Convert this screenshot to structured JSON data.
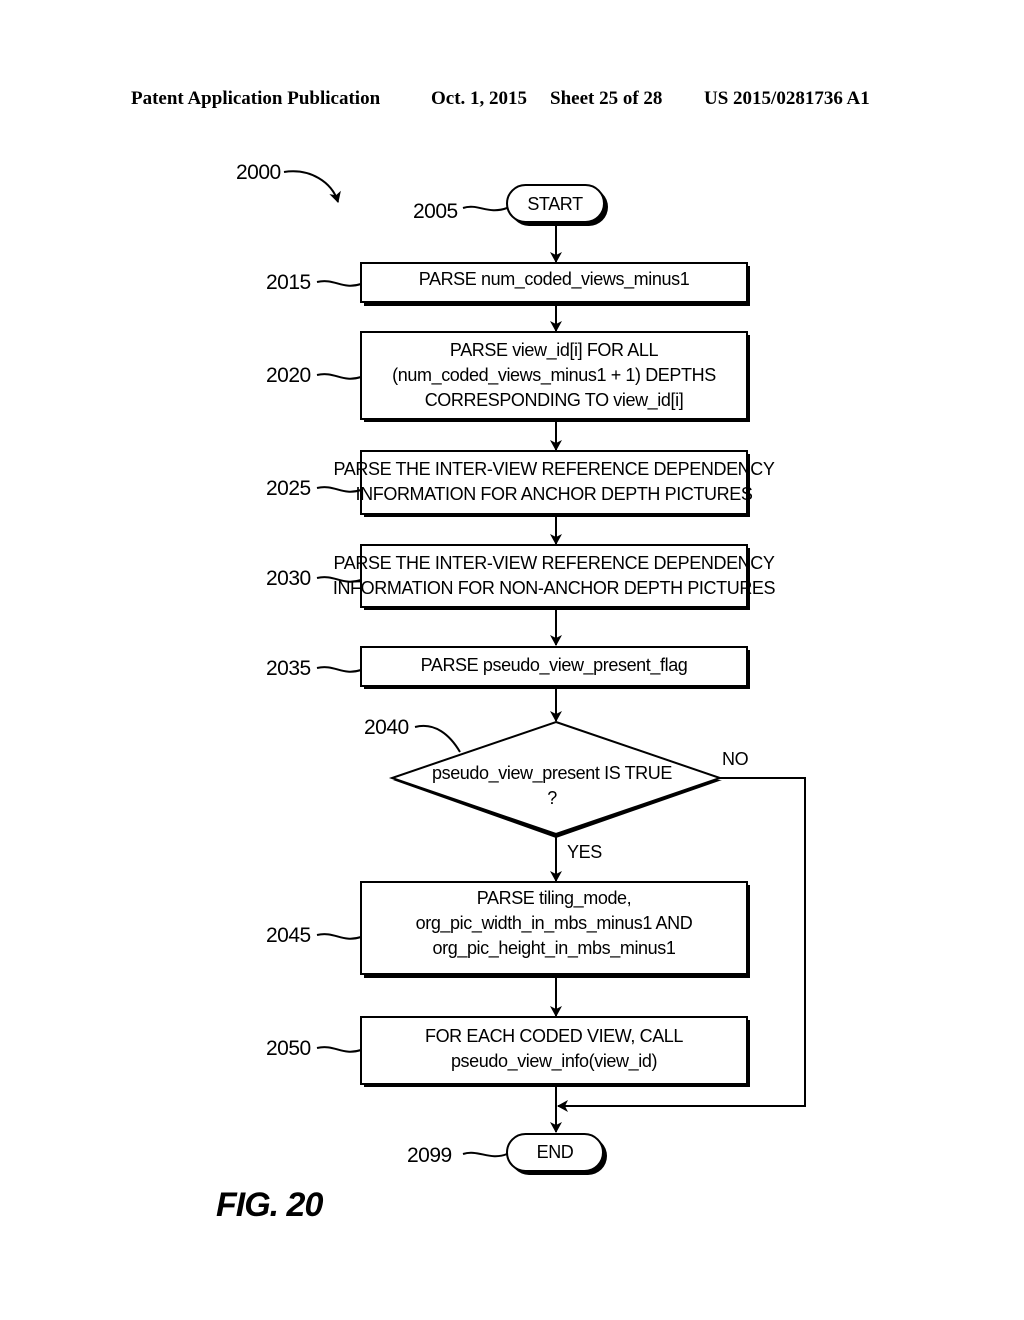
{
  "header": {
    "publication": "Patent Application Publication",
    "date": "Oct. 1, 2015",
    "sheet": "Sheet 25 of 28",
    "number": "US 2015/0281736 A1"
  },
  "figure": {
    "label": "FIG. 20",
    "ref": "2000"
  },
  "flowchart": {
    "start": {
      "ref": "2005",
      "label": "START"
    },
    "steps": [
      {
        "ref": "2015",
        "lines": [
          "PARSE num_coded_views_minus1"
        ]
      },
      {
        "ref": "2020",
        "lines": [
          "PARSE view_id[i] FOR ALL",
          "(num_coded_views_minus1 + 1) DEPTHS",
          "CORRESPONDING TO view_id[i]"
        ]
      },
      {
        "ref": "2025",
        "lines": [
          "PARSE THE INTER-VIEW REFERENCE DEPENDENCY",
          "INFORMATION FOR ANCHOR DEPTH PICTURES"
        ]
      },
      {
        "ref": "2030",
        "lines": [
          "PARSE THE INTER-VIEW REFERENCE DEPENDENCY",
          "INFORMATION FOR NON-ANCHOR DEPTH PICTURES"
        ]
      },
      {
        "ref": "2035",
        "lines": [
          "PARSE pseudo_view_present_flag"
        ]
      }
    ],
    "decision": {
      "ref": "2040",
      "lines": [
        "pseudo_view_present IS TRUE",
        "?"
      ],
      "yes_label": "YES",
      "no_label": "NO"
    },
    "steps_after": [
      {
        "ref": "2045",
        "lines": [
          "PARSE tiling_mode,",
          "org_pic_width_in_mbs_minus1 AND",
          "org_pic_height_in_mbs_minus1"
        ]
      },
      {
        "ref": "2050",
        "lines": [
          "FOR EACH CODED VIEW, CALL",
          "pseudo_view_info(view_id)"
        ]
      }
    ],
    "end": {
      "ref": "2099",
      "label": "END"
    }
  }
}
